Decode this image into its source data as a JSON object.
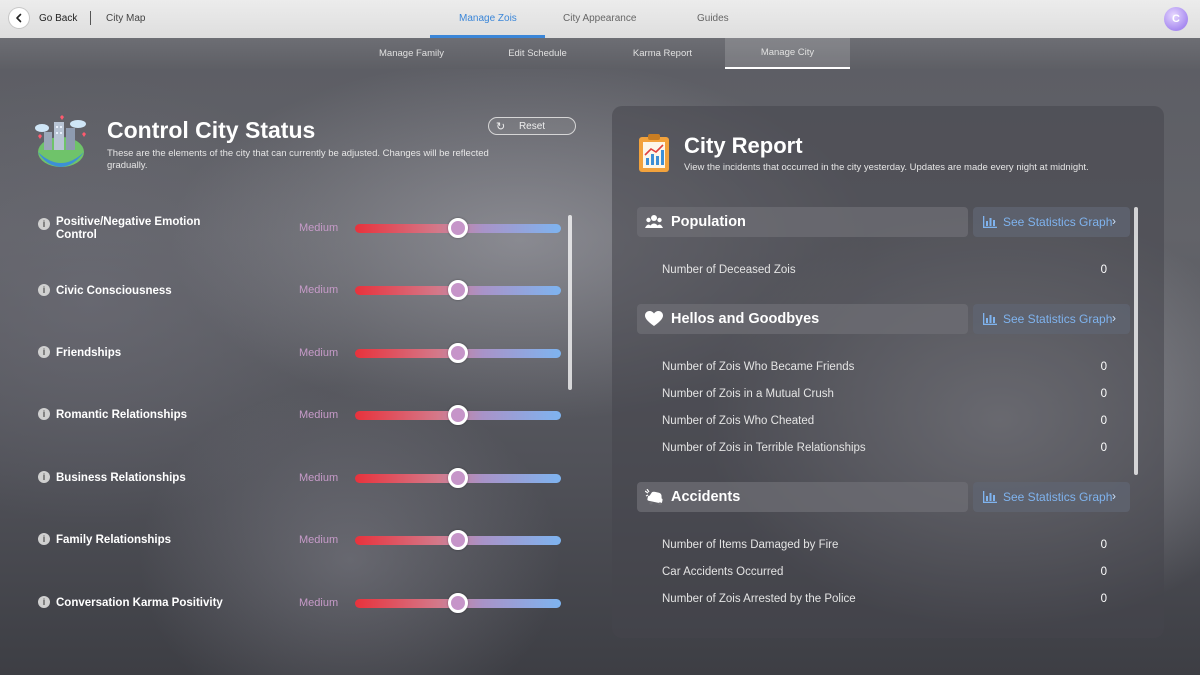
{
  "topbar": {
    "back_label": "Go Back",
    "breadcrumb": "City Map",
    "tabs": [
      {
        "label": "Manage Zois",
        "active": true
      },
      {
        "label": "City Appearance",
        "active": false
      },
      {
        "label": "Guides",
        "active": false
      }
    ],
    "avatar_letter": "C"
  },
  "subtabs": [
    {
      "label": "Manage Family",
      "active": false
    },
    {
      "label": "Edit Schedule",
      "active": false
    },
    {
      "label": "Karma Report",
      "active": false
    },
    {
      "label": "Manage City",
      "active": true
    }
  ],
  "control": {
    "title": "Control City Status",
    "description": "These are the elements of the city that can currently be adjusted. Changes will be reflected gradually.",
    "reset_label": "Reset",
    "rows": [
      {
        "label": "Positive/Negative Emotion Control",
        "value": "Medium",
        "level": 0.5
      },
      {
        "label": "Civic Consciousness",
        "value": "Medium",
        "level": 0.5
      },
      {
        "label": "Friendships",
        "value": "Medium",
        "level": 0.5
      },
      {
        "label": "Romantic Relationships",
        "value": "Medium",
        "level": 0.5
      },
      {
        "label": "Business Relationships",
        "value": "Medium",
        "level": 0.5
      },
      {
        "label": "Family Relationships",
        "value": "Medium",
        "level": 0.5
      },
      {
        "label": "Conversation Karma Positivity",
        "value": "Medium",
        "level": 0.5
      }
    ]
  },
  "report": {
    "title": "City Report",
    "description": "View the incidents that occurred in the city yesterday. Updates are made every night at midnight.",
    "stats_button_label": "See Statistics Graph",
    "sections": [
      {
        "title": "Population",
        "icon": "people-icon",
        "items": [
          {
            "label": "Number of Deceased Zois",
            "value": "0"
          }
        ]
      },
      {
        "title": "Hellos and Goodbyes",
        "icon": "heart-icon",
        "items": [
          {
            "label": "Number of Zois Who Became Friends",
            "value": "0"
          },
          {
            "label": "Number of Zois in a Mutual Crush",
            "value": "0"
          },
          {
            "label": "Number of Zois Who Cheated",
            "value": "0"
          },
          {
            "label": "Number of Zois in Terrible Relationships",
            "value": "0"
          }
        ]
      },
      {
        "title": "Accidents",
        "icon": "car-crash-icon",
        "items": [
          {
            "label": "Number of Items Damaged by Fire",
            "value": "0"
          },
          {
            "label": "Car Accidents Occurred",
            "value": "0"
          },
          {
            "label": "Number of Zois Arrested by the Police",
            "value": "0"
          }
        ]
      }
    ]
  }
}
